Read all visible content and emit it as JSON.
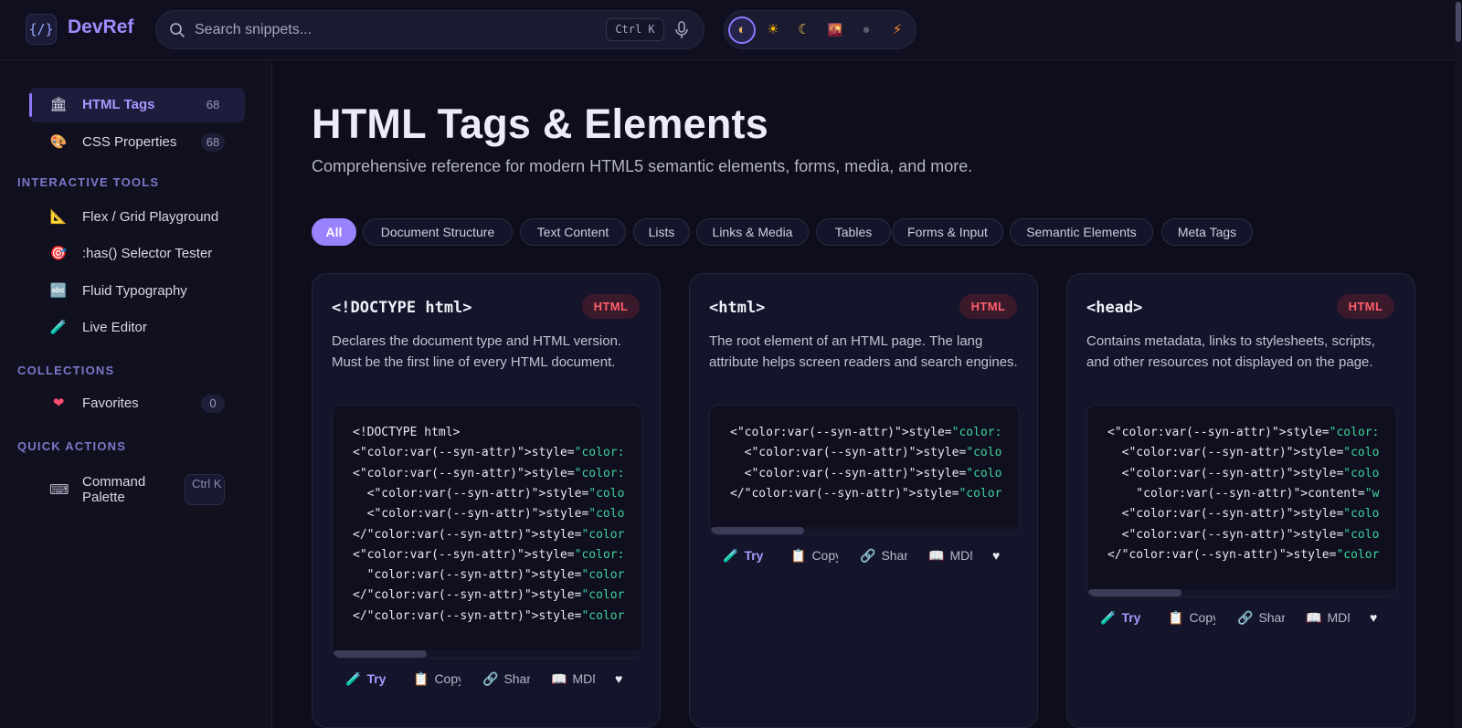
{
  "app": {
    "logo_text": "{/}",
    "name": "DevRef"
  },
  "search": {
    "placeholder": "Search snippets...",
    "shortcut": "Ctrl K"
  },
  "themes": [
    {
      "name": "auto",
      "glyph": "◐"
    },
    {
      "name": "light",
      "glyph": "☀"
    },
    {
      "name": "dark",
      "glyph": "☾"
    },
    {
      "name": "sunset",
      "glyph": "🌇"
    },
    {
      "name": "midnight",
      "glyph": "●"
    },
    {
      "name": "energy",
      "glyph": "⚡"
    }
  ],
  "sidebar": {
    "items": [
      {
        "label": "HTML Tags",
        "count": "68",
        "icon": "🏛",
        "active": true
      },
      {
        "label": "CSS Properties",
        "count": "68",
        "icon": "🎨"
      }
    ],
    "tools_title": "INTERACTIVE TOOLS",
    "tools": [
      {
        "label": "Flex / Grid Playground",
        "icon": "📐"
      },
      {
        "label": ":has() Selector Tester",
        "icon": "🎯"
      },
      {
        "label": "Fluid Typography",
        "icon": "🔤"
      },
      {
        "label": "Live Editor",
        "icon": "🧪"
      }
    ],
    "collections_title": "COLLECTIONS",
    "favorites": {
      "label": "Favorites",
      "count": "0",
      "icon": "❤"
    },
    "quick_title": "QUICK ACTIONS",
    "command": {
      "label": "Command Palette",
      "shortcut": "Ctrl K",
      "icon": "⌨"
    }
  },
  "main": {
    "title": "HTML Tags & Elements",
    "subtitle": "Comprehensive reference for modern HTML5 semantic elements, forms, media, and more.",
    "filters": [
      "All",
      "Document Structure",
      "Text Content",
      "Lists",
      "Links & Media",
      "Tables",
      "Forms & Input",
      "Semantic Elements",
      "Meta Tags"
    ],
    "active_filter": "All"
  },
  "cards": [
    {
      "title": "<!DOCTYPE html>",
      "badge": "HTML",
      "description": "Declares the document type and HTML version. Must be the first line of every HTML document.",
      "code": [
        [
          "<!DOCTYPE html>",
          ""
        ],
        [
          "<\"color:var(--syn-attr)\">style=",
          "\"color:"
        ],
        [
          "<\"color:var(--syn-attr)\">style=",
          "\"color:"
        ],
        [
          "  <\"color:var(--syn-attr)\">style=",
          "\"colo"
        ],
        [
          "  <\"color:var(--syn-attr)\">style=",
          "\"colo"
        ],
        [
          "</\"color:var(--syn-attr)\">style=",
          "\"color"
        ],
        [
          "<\"color:var(--syn-attr)\">style=",
          "\"color:"
        ],
        [
          "  \"color:var(--syn-attr)\">style=",
          "\"color"
        ],
        [
          "</\"color:var(--syn-attr)\">style=",
          "\"color"
        ],
        [
          "</\"color:var(--syn-attr)\">style=",
          "\"color"
        ]
      ],
      "actions": {
        "try": "Try",
        "copy": "Copy",
        "share": "Share",
        "mdn": "MDN"
      }
    },
    {
      "title": "<html>",
      "badge": "HTML",
      "description": "The root element of an HTML page. The lang attribute helps screen readers and search engines.",
      "code": [
        [
          "<\"color:var(--syn-attr)\">style=",
          "\"color:"
        ],
        [
          "  <\"color:var(--syn-attr)\">style=",
          "\"colo"
        ],
        [
          "  <\"color:var(--syn-attr)\">style=",
          "\"colo"
        ],
        [
          "</\"color:var(--syn-attr)\">style=",
          "\"color"
        ]
      ],
      "actions": {
        "try": "Try",
        "copy": "Copy",
        "share": "Share",
        "mdn": "MDN"
      }
    },
    {
      "title": "<head>",
      "badge": "HTML",
      "description": "Contains metadata, links to stylesheets, scripts, and other resources not displayed on the page.",
      "code": [
        [
          "<\"color:var(--syn-attr)\">style=",
          "\"color:"
        ],
        [
          "  <\"color:var(--syn-attr)\">style=",
          "\"colo"
        ],
        [
          "  <\"color:var(--syn-attr)\">style=",
          "\"colo"
        ],
        [
          "    \"color:var(--syn-attr)\">content=",
          "\"w"
        ],
        [
          "  <\"color:var(--syn-attr)\">style=",
          "\"colo"
        ],
        [
          "  <\"color:var(--syn-attr)\">style=",
          "\"colo"
        ],
        [
          "</\"color:var(--syn-attr)\">style=",
          "\"color"
        ]
      ],
      "actions": {
        "try": "Try",
        "copy": "Copy",
        "share": "Share",
        "mdn": "MDN"
      }
    }
  ],
  "colors": {
    "accent": "#9a82ff",
    "badge_text": "#ff5d6c",
    "code_string": "#3fd39a",
    "background": "#0d0d1b"
  }
}
